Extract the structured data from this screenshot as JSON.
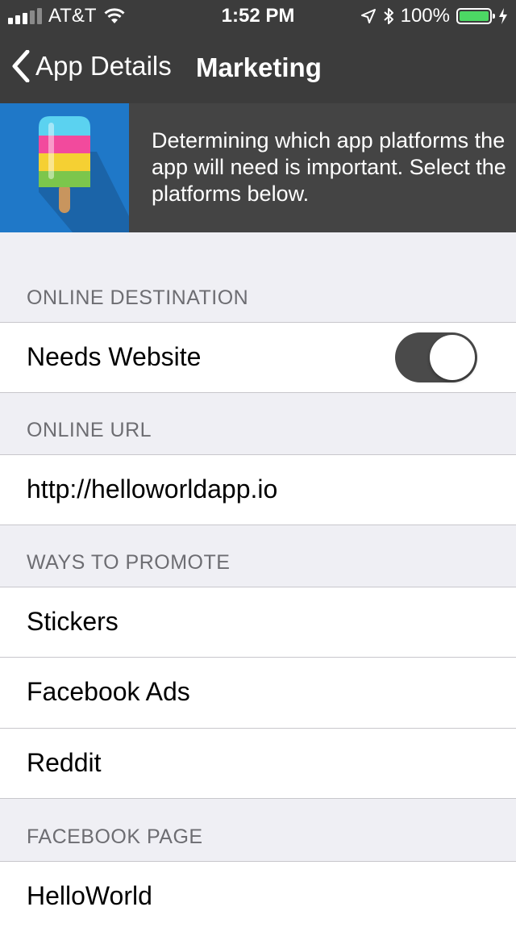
{
  "status_bar": {
    "carrier": "AT&T",
    "time": "1:52 PM",
    "battery": "100%",
    "icons": [
      "signal-icon",
      "wifi-icon",
      "location-arrow-icon",
      "bluetooth-icon",
      "battery-icon",
      "charging-bolt-icon"
    ]
  },
  "nav": {
    "back_label": "App Details",
    "title": "Marketing"
  },
  "banner": {
    "icon": "popsicle-icon",
    "text": "Determining which app platforms the app will need is important. Select the platforms below."
  },
  "sections": {
    "online_destination": {
      "header": "ONLINE DESTINATION",
      "needs_website_label": "Needs Website",
      "needs_website_on": true
    },
    "online_url": {
      "header": "ONLINE URL",
      "value": "http://helloworldapp.io"
    },
    "ways_to_promote": {
      "header": "WAYS TO PROMOTE",
      "items": [
        "Stickers",
        "Facebook Ads",
        "Reddit"
      ]
    },
    "facebook_page": {
      "header": "FACEBOOK PAGE",
      "value": "HelloWorld"
    }
  },
  "colors": {
    "nav_background": "#3c3c3c",
    "banner_icon_background": "#1f78c8",
    "toggle_on": "#4a4a4a",
    "group_background": "#efeff4"
  }
}
